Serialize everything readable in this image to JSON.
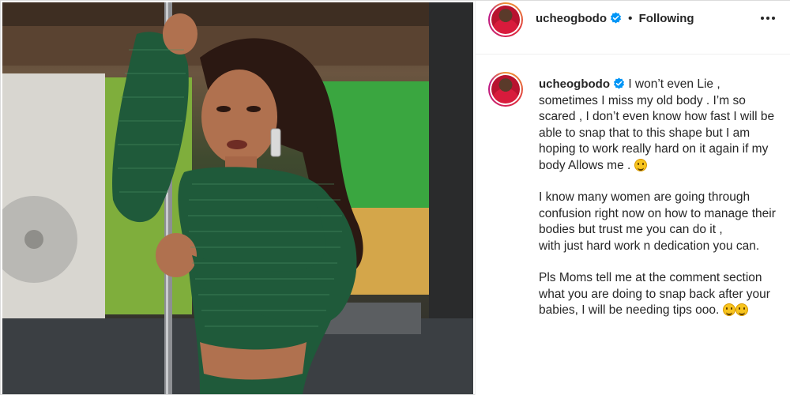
{
  "post": {
    "image_alt": "",
    "header": {
      "username": "ucheogbodo",
      "separator": "•",
      "follow_status": "Following"
    },
    "caption": {
      "username": "ucheogbodo",
      "paragraph_1": "I won’t even Lie , sometimes I miss my old body . I’m so scared , I don’t even know how fast I will be able to snap that to this shape but I am hoping to work really hard on it again if my body Allows me .",
      "paragraph_2_line_1": "I know many women are going through confusion right now on how to manage their bodies but trust me you can do it ,",
      "paragraph_2_line_2": "with just hard work n dedication you can.",
      "paragraph_3": "Pls Moms tell me at the comment section what you are doing to snap back after your babies, I will be needing tips ooo."
    },
    "icons": {
      "verified": "verified-badge-icon",
      "more": "more-options-icon",
      "emoji_grin": "grimacing-emoji-icon",
      "emoji_smile": "smiling-emoji-icon"
    },
    "colors": {
      "verified_blue": "#0095f6",
      "text": "#262626",
      "border": "#efefef",
      "dress_green": "#1f5a3a"
    }
  }
}
